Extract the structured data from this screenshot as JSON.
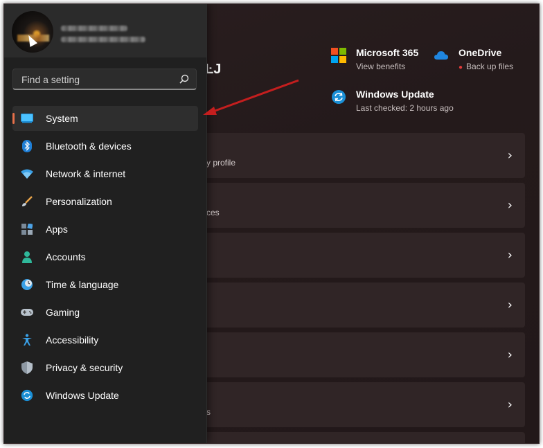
{
  "header": {
    "partial_title": "ĿJ"
  },
  "services": [
    {
      "name": "Microsoft 365",
      "sub": "View benefits",
      "icon": "microsoft-logo-icon"
    },
    {
      "name": "OneDrive",
      "sub": "Back up files",
      "icon": "onedrive-cloud-icon"
    },
    {
      "name": "Windows Update",
      "sub": "Last checked: 2 hours ago",
      "icon": "windows-update-icon"
    }
  ],
  "cards": [
    {
      "sub": "y profile"
    },
    {
      "sub": "ces"
    },
    {
      "sub": ""
    },
    {
      "sub": ""
    },
    {
      "sub": ""
    },
    {
      "sub": "s"
    }
  ],
  "search": {
    "placeholder": "Find a setting"
  },
  "nav": {
    "items": [
      {
        "label": "System",
        "icon": "display-icon",
        "active": true
      },
      {
        "label": "Bluetooth & devices",
        "icon": "bluetooth-icon"
      },
      {
        "label": "Network & internet",
        "icon": "wifi-icon"
      },
      {
        "label": "Personalization",
        "icon": "brush-icon"
      },
      {
        "label": "Apps",
        "icon": "apps-icon"
      },
      {
        "label": "Accounts",
        "icon": "person-icon"
      },
      {
        "label": "Time & language",
        "icon": "clock-globe-icon"
      },
      {
        "label": "Gaming",
        "icon": "gamepad-icon"
      },
      {
        "label": "Accessibility",
        "icon": "accessibility-icon"
      },
      {
        "label": "Privacy & security",
        "icon": "shield-icon"
      },
      {
        "label": "Windows Update",
        "icon": "windows-update-icon"
      }
    ]
  },
  "colors": {
    "accent": "#e6704a",
    "annotation_arrow": "#c41e1e",
    "notification_dot": "#e03a3a"
  }
}
